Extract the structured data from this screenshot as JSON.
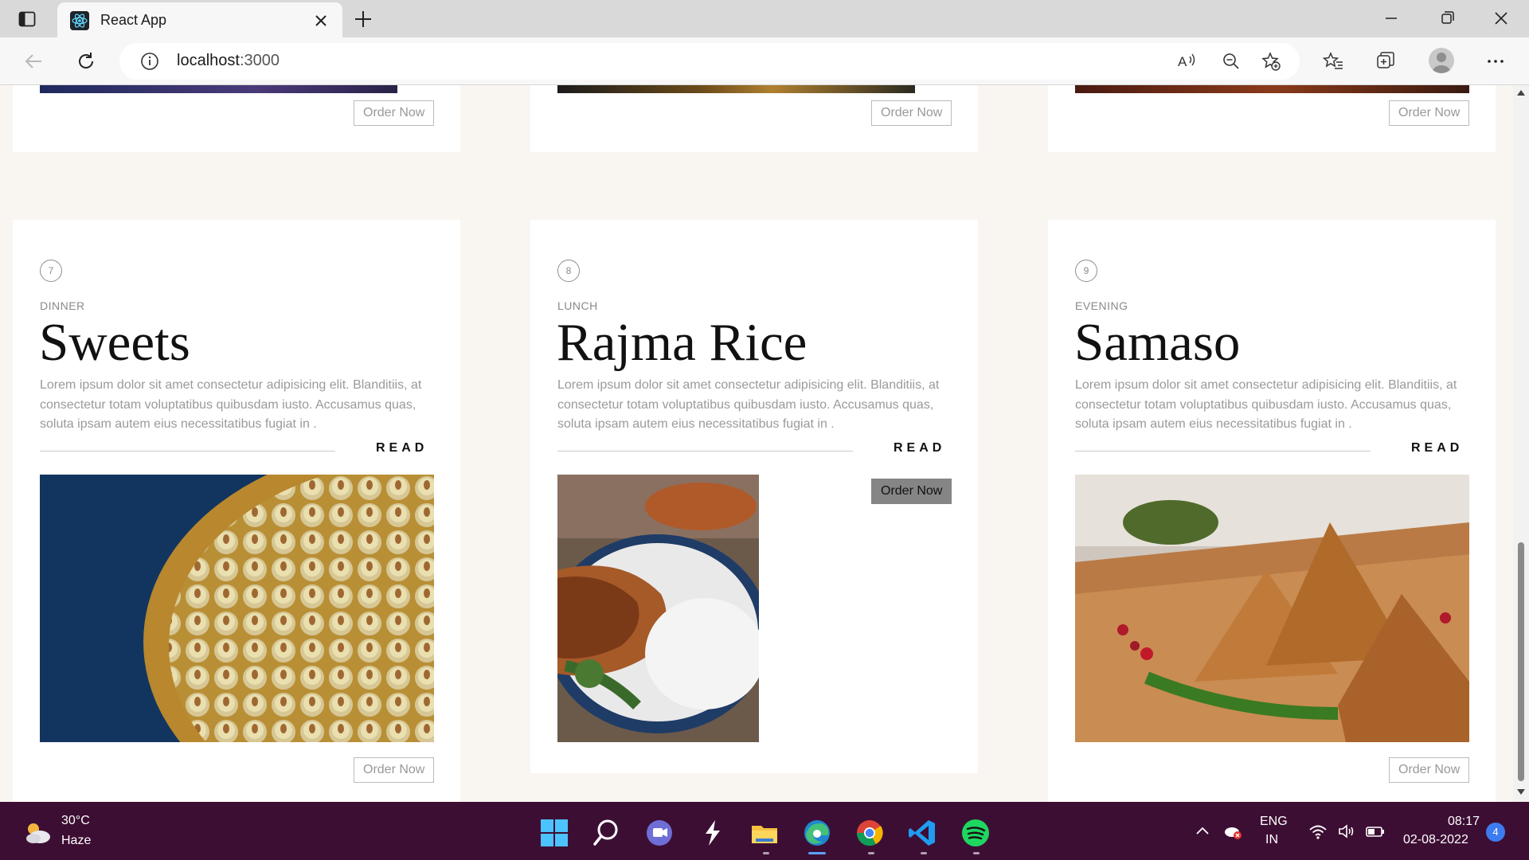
{
  "browser": {
    "tab_title": "React App",
    "url_host": "localhost",
    "url_port": ":3000"
  },
  "top_row": {
    "cards": [
      {
        "order_label": "Order Now"
      },
      {
        "order_label": "Order Now"
      },
      {
        "order_label": "Order Now"
      }
    ]
  },
  "menu": {
    "cards": [
      {
        "number": "7",
        "category": "DINNER",
        "title": "Sweets",
        "description": "Lorem ipsum dolor sit amet consectetur adipisicing elit. Blanditiis, at consectetur totam voluptatibus quibusdam iusto. Accusamus quas, soluta ipsam autem eius necessitatibus fugiat in .",
        "read_label": "READ",
        "order_label": "Order Now",
        "image": "sweets-platter"
      },
      {
        "number": "8",
        "category": "LUNCH",
        "title": "Rajma Rice",
        "description": "Lorem ipsum dolor sit amet consectetur adipisicing elit. Blanditiis, at consectetur totam voluptatibus quibusdam iusto. Accusamus quas, soluta ipsam autem eius necessitatibus fugiat in .",
        "read_label": "READ",
        "order_label": "Order Now",
        "image": "rajma-rice-bowl"
      },
      {
        "number": "9",
        "category": "EVENING",
        "title": "Samaso",
        "description": "Lorem ipsum dolor sit amet consectetur adipisicing elit. Blanditiis, at consectetur totam voluptatibus quibusdam iusto. Accusamus quas, soluta ipsam autem eius necessitatibus fugiat in .",
        "read_label": "READ",
        "order_label": "Order Now",
        "image": "samosa-plate"
      }
    ]
  },
  "taskbar": {
    "weather_temp": "30°C",
    "weather_condition": "Haze",
    "lang_primary": "ENG",
    "lang_secondary": "IN",
    "time": "08:17",
    "date": "02-08-2022",
    "notification_count": "4"
  },
  "colors": {
    "page_bg": "#f9f6f2",
    "card_bg": "#ffffff",
    "taskbar_bg": "#3d0e33",
    "order_hover_bg": "#858585"
  }
}
